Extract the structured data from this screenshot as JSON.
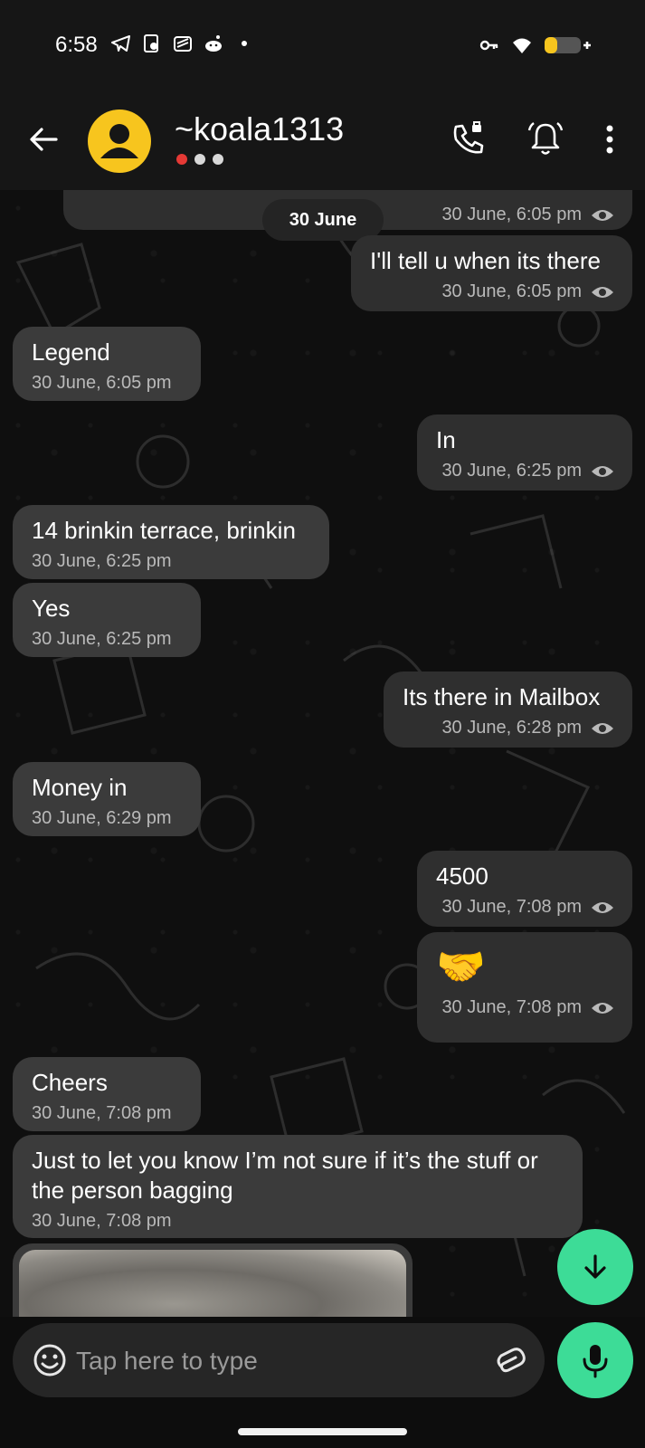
{
  "status_bar": {
    "time": "6:58",
    "left_icons": [
      "telegram-icon",
      "photo-icon",
      "stack-icon",
      "reddit-icon",
      "dot-icon"
    ],
    "right_icons": [
      "vpn-key-icon",
      "wifi-icon",
      "battery-icon"
    ]
  },
  "header": {
    "contact_name": "~koala1313",
    "presence_dots": [
      "#e53935",
      "#d8d8d8",
      "#d8d8d8"
    ]
  },
  "chat": {
    "date_chip": "30 June",
    "messages": [
      {
        "direction": "out",
        "text": "",
        "time": "30 June, 6:05 pm",
        "seen": true
      },
      {
        "direction": "out",
        "text": "I'll tell u when its there",
        "time": "30 June, 6:05 pm",
        "seen": true
      },
      {
        "direction": "in",
        "text": "Legend",
        "time": "30 June, 6:05 pm"
      },
      {
        "direction": "out",
        "text": "In",
        "time": "30 June, 6:25 pm",
        "seen": true
      },
      {
        "direction": "in",
        "text": "14 brinkin terrace, brinkin",
        "time": "30 June, 6:25 pm"
      },
      {
        "direction": "in",
        "text": "Yes",
        "time": "30 June, 6:25 pm"
      },
      {
        "direction": "out",
        "text": "Its there in Mailbox",
        "time": "30 June, 6:28 pm",
        "seen": true
      },
      {
        "direction": "in",
        "text": "Money in",
        "time": "30 June, 6:29 pm"
      },
      {
        "direction": "out",
        "text": "4500",
        "time": "30 June, 7:08 pm",
        "seen": true
      },
      {
        "direction": "out",
        "text": "🤝",
        "time": "30 June, 7:08 pm",
        "seen": true
      },
      {
        "direction": "in",
        "text": "Cheers",
        "time": "30 June, 7:08 pm"
      },
      {
        "direction": "in",
        "text": "Just to let you know I’m not sure if it’s the stuff or the person bagging",
        "time": "30 June, 7:08 pm"
      }
    ]
  },
  "composer": {
    "placeholder": "Tap here to type"
  },
  "colors": {
    "accent": "#3ddc97",
    "avatar": "#f7c51e",
    "bubble_in": "#3b3b3b",
    "bubble_out": "#2f2f2f"
  }
}
